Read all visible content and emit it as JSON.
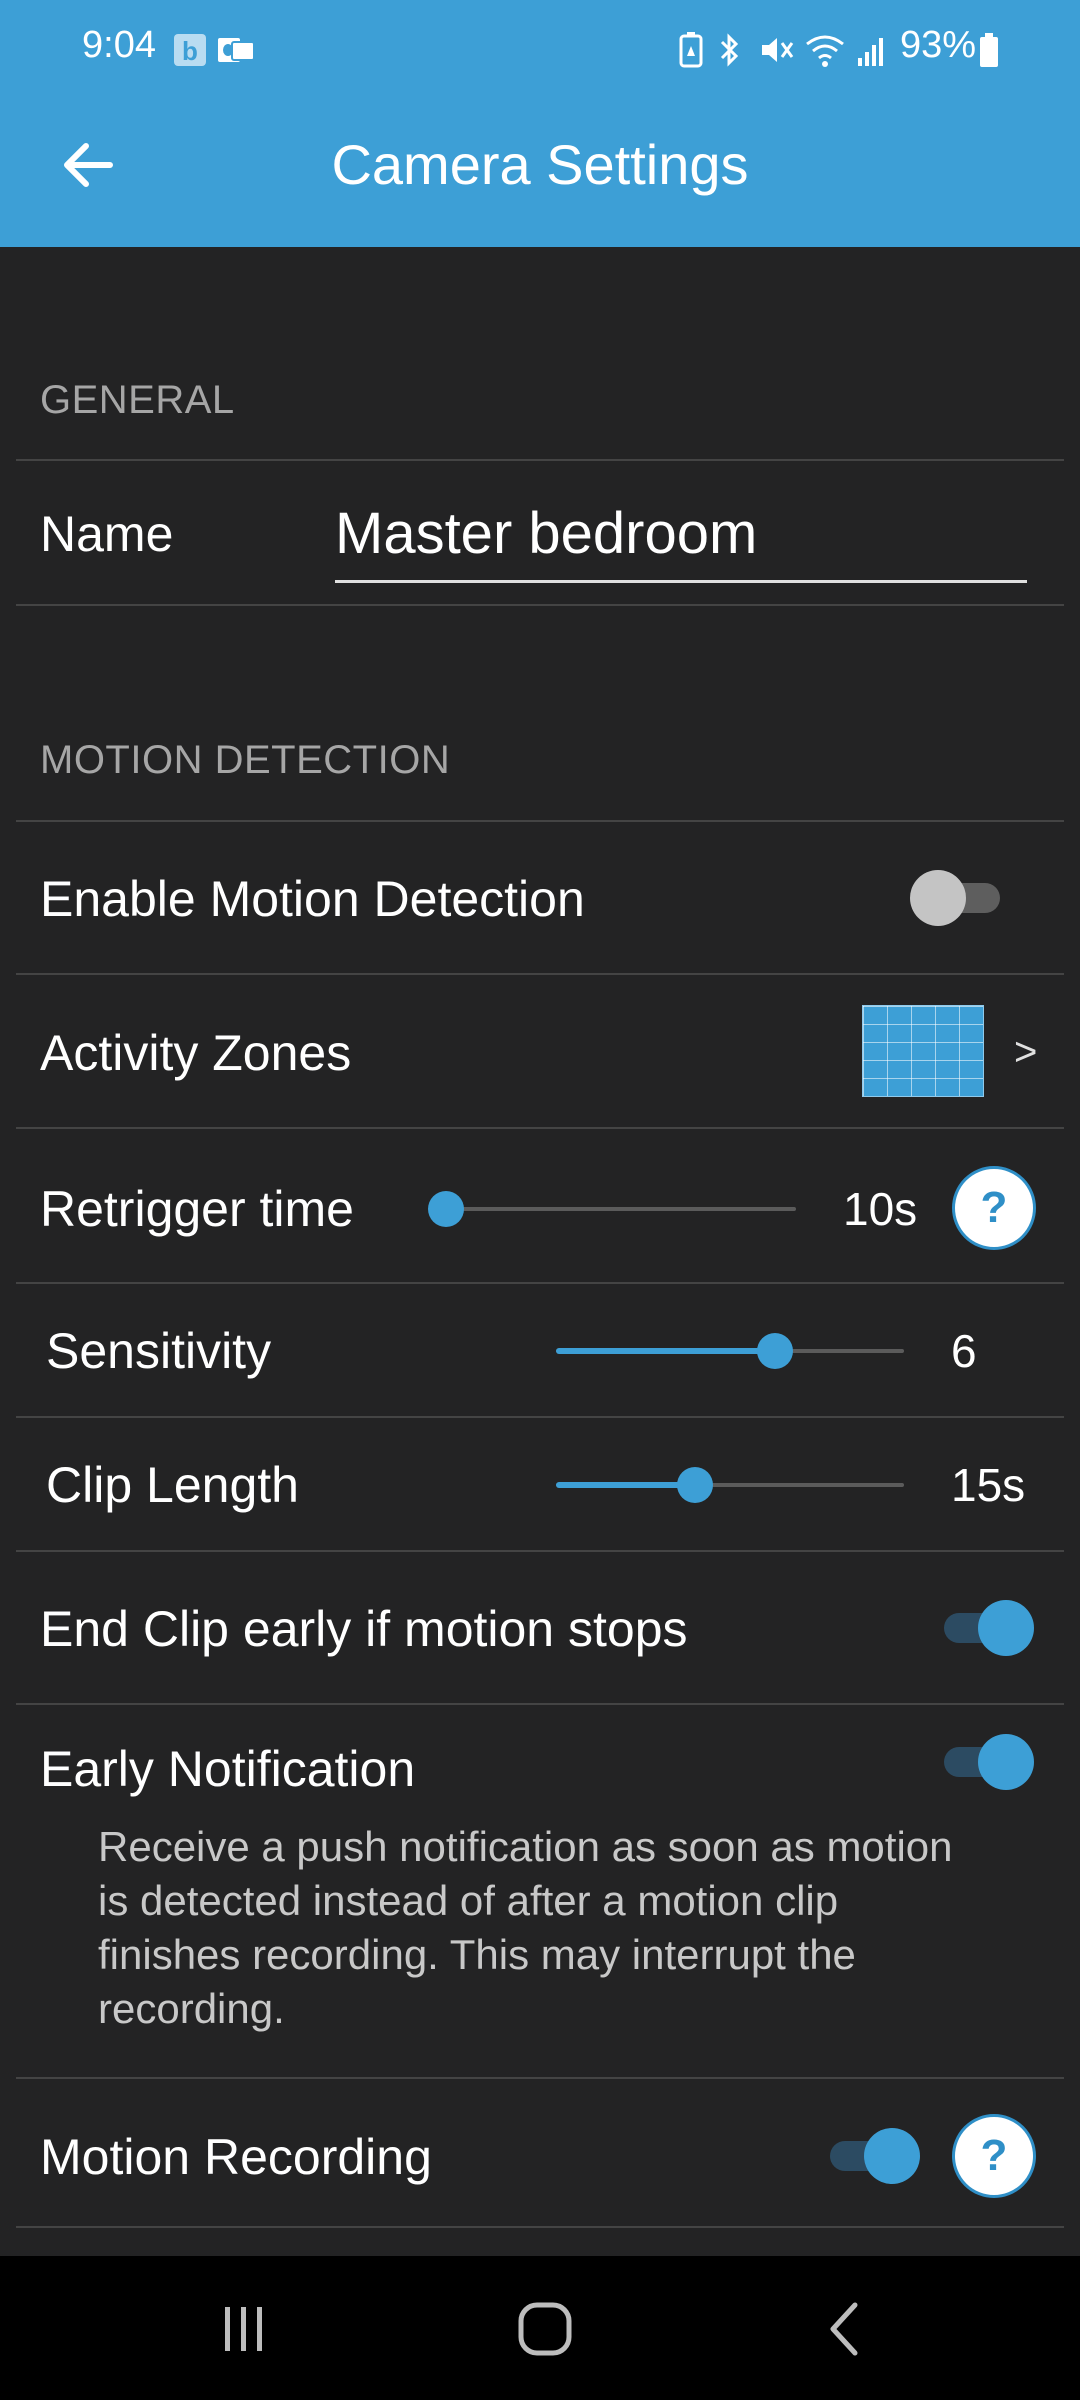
{
  "status_bar": {
    "time": "9:04",
    "battery_percent": "93%",
    "icons": [
      "b-app-icon",
      "outlook-icon",
      "battery-saver-icon",
      "bluetooth-icon",
      "mute-icon",
      "wifi-icon",
      "signal-icon",
      "battery-icon"
    ]
  },
  "header": {
    "title": "Camera Settings",
    "back_icon": "arrow-left-icon",
    "background_color": "#3d9fd6"
  },
  "general": {
    "section_label": "GENERAL",
    "name_label": "Name",
    "name_value": "Master bedroom"
  },
  "motion_detection": {
    "section_label": "MOTION DETECTION",
    "enable_label": "Enable Motion Detection",
    "enable_on": false,
    "activity_zones_label": "Activity Zones",
    "activity_zones_chevron": ">",
    "retrigger_label": "Retrigger time",
    "retrigger_value": "10s",
    "retrigger_fraction": 0.0,
    "sensitivity_label": "Sensitivity",
    "sensitivity_value": "6",
    "sensitivity_fraction": 0.63,
    "clip_length_label": "Clip Length",
    "clip_length_value": "15s",
    "clip_length_fraction": 0.4,
    "end_clip_label": "End Clip early if motion stops",
    "end_clip_on": true,
    "early_notification_label": "Early Notification",
    "early_notification_on": true,
    "early_notification_desc": "Receive a push notification as soon as motion is detected instead of after a motion clip finishes recording. This may interrupt the recording.",
    "motion_recording_label": "Motion Recording",
    "motion_recording_on": true,
    "help_label": "?"
  },
  "nav": {
    "recents_icon": "recents-icon",
    "home_icon": "home-icon",
    "back_icon": "chevron-left-icon"
  },
  "colors": {
    "accent": "#3d9fd6",
    "background": "#232324",
    "divider": "#444444"
  }
}
